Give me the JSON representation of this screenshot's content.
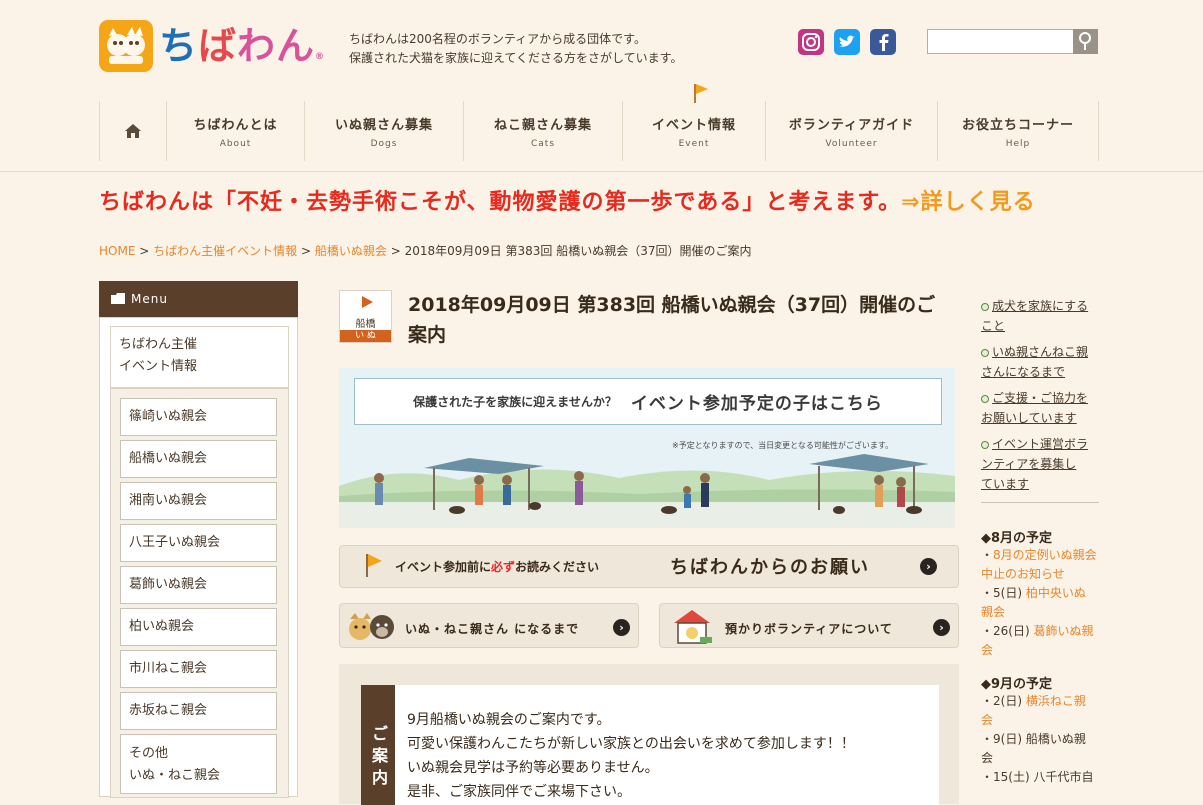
{
  "header": {
    "logo_text_1": "ち",
    "logo_text_2": "ば",
    "logo_text_3": "わん",
    "logo_mark": "®",
    "tagline_1": "ちばわんは200名程のボランティアから成る団体です。",
    "tagline_2": "保護された犬猫を家族に迎えてくださる方をさがしています。",
    "search_placeholder": "",
    "search_icon": "search-icon"
  },
  "nav": {
    "items": [
      {
        "jp": "",
        "en": "",
        "icon": "home-icon"
      },
      {
        "jp": "ちばわんとは",
        "en": "About"
      },
      {
        "jp": "いぬ親さん募集",
        "en": "Dogs"
      },
      {
        "jp": "ねこ親さん募集",
        "en": "Cats"
      },
      {
        "jp": "イベント情報",
        "en": "Event"
      },
      {
        "jp": "ボランティアガイド",
        "en": "Volunteer"
      },
      {
        "jp": "お役立ちコーナー",
        "en": "Help"
      }
    ]
  },
  "headline": {
    "text": "ちばわんは「不妊・去勢手術こそが、動物愛護の第一歩である」と考えます。",
    "more": "⇒詳しく見る"
  },
  "breadcrumb": {
    "home": "HOME",
    "sep": ">",
    "level1": "ちばわん主催イベント情報",
    "level2": "船橋いぬ親会",
    "current": "2018年09月09日 第383回 船橋いぬ親会（37回）開催のご案内"
  },
  "sidebar": {
    "menu_label": "Menu",
    "parent_line1": "ちばわん主催",
    "parent_line2": "イベント情報",
    "items": [
      "篠崎いぬ親会",
      "船橋いぬ親会",
      "湘南いぬ親会",
      "八王子いぬ親会",
      "葛飾いぬ親会",
      "柏いぬ親会",
      "市川ねこ親会",
      "赤坂ねこ親会"
    ],
    "other_line1": "その他",
    "other_line2": "いぬ・ねこ親会"
  },
  "article": {
    "badge_label": "船橋",
    "badge_bar": "い ぬ",
    "title": "2018年09月09日 第383回 船橋いぬ親会（37回）開催のご案内",
    "hero_small": "保護された子を家族に迎えませんか？",
    "hero_big": "イベント参加予定の子はこちら",
    "hero_note": "※予定となりますので、当日変更となる可能性がございます。",
    "request_prefix": "イベント参加前に",
    "request_must": "必ず",
    "request_suffix": "お読みください",
    "request_big": "ちばわんからのお願い",
    "btn_parents": "いぬ・ねこ親さん になるまで",
    "btn_foster": "預かりボランティアについて",
    "info_tab": "ご案内",
    "info_lines": [
      "9月船橋いぬ親会のご案内です。",
      "可愛い保護わんこたちが新しい家族との出会いを求めて参加します！！",
      "いぬ親会見学は予約等必要ありません。",
      "是非、ご家族同伴でご来場下さい。"
    ]
  },
  "right": {
    "links": [
      {
        "l1": "成犬を家族にする",
        "l2": "こと"
      },
      {
        "l1": "いぬ親さんねこ親",
        "l2": "さんになるまで"
      },
      {
        "l1": "ご支援・ご協力を",
        "l2": "お願いしています"
      },
      {
        "l1": "イベント運営ボラ",
        "l2": "ンティアを募集し",
        "l3": "ています"
      }
    ],
    "aug_head": "◆8月の予定",
    "aug_items": [
      {
        "pre": "・",
        "link": "8月の定例いぬ親会中止のお知らせ",
        "l1": "8月の定例いぬ親会",
        "l2": "中止のお知らせ"
      },
      {
        "pre": "・5(日) ",
        "l1": "柏中央いぬ",
        "l2": "親会"
      },
      {
        "pre": "・26(日) ",
        "l1": "葛飾いぬ親",
        "l2": "会"
      }
    ],
    "sep_head": "◆9月の予定",
    "sep_items": [
      {
        "pre": "・2(日) ",
        "l1": "横浜ねこ親",
        "l2": "会"
      },
      {
        "pre": "・9(日) ",
        "l1": "船橋いぬ親",
        "l2": "会"
      },
      {
        "pre": "・15(土) ",
        "l1": "八千代市自",
        "l2": ""
      }
    ]
  },
  "colors": {
    "accent_orange": "#e8862a",
    "headline_red": "#e82a1e",
    "menu_brown": "#5a3f2a",
    "background": "#fbf3e8"
  }
}
